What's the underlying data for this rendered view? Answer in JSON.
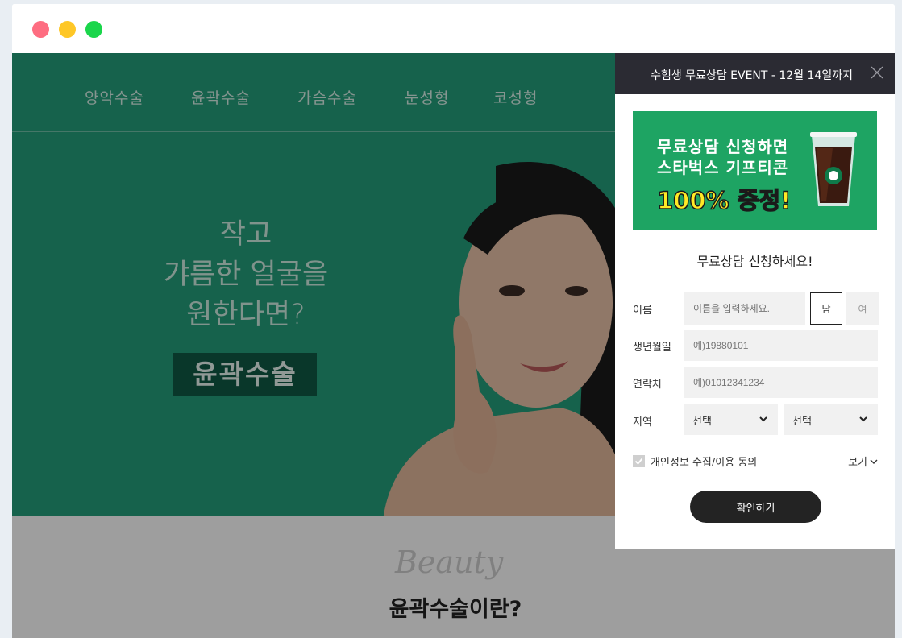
{
  "nav": {
    "items": [
      "양악수술",
      "윤곽수술",
      "가슴수술",
      "눈성형",
      "코성형"
    ]
  },
  "hero": {
    "line1": "작고",
    "line2": "갸름한 얼굴을",
    "line3": "원한다면?",
    "badge": "윤곽수술"
  },
  "lower": {
    "script_word": "Beauty",
    "title": "윤곽수술이란?"
  },
  "popup": {
    "header_title": "수험생 무료상담 EVENT - 12월 14일까지",
    "banner": {
      "line1": "무료상담 신청하면",
      "line2": "스타벅스 기프티콘",
      "line3": "100% 증정!"
    },
    "form_title": "무료상담 신청하세요!",
    "name_label": "이름",
    "name_placeholder": "이름을 입력하세요.",
    "gender_male": "남",
    "gender_female": "여",
    "birth_label": "생년월일",
    "birth_placeholder": "예)19880101",
    "phone_label": "연락처",
    "phone_placeholder": "예)01012341234",
    "region_label": "지역",
    "region_select1": "선택",
    "region_select2": "선택",
    "agree_label": "개인정보 수집/이용 동의",
    "view_label": "보기",
    "submit_label": "확인하기"
  },
  "colors": {
    "hero_bg": "#249e7b",
    "popup_header_bg": "#2b2b33",
    "banner_bg": "#1ea463",
    "submit_bg": "#232323"
  }
}
